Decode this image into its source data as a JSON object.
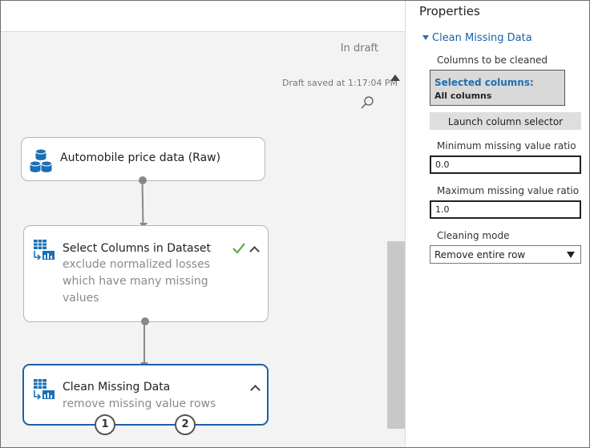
{
  "canvas": {
    "status": "In draft",
    "saved_text": "Draft saved at 1:17:04 PM",
    "modules": [
      {
        "title": "Automobile price data (Raw)",
        "description": ""
      },
      {
        "title": "Select Columns in Dataset",
        "description": "exclude normalized losses which have many missing values"
      },
      {
        "title": "Clean Missing Data",
        "description": "remove missing value rows"
      }
    ],
    "output_ports": [
      "1",
      "2"
    ]
  },
  "properties": {
    "title": "Properties",
    "section": "Clean Missing Data",
    "columns_label": "Columns to be cleaned",
    "selected_columns_label": "Selected columns:",
    "selected_columns_value": "All columns",
    "launch_button": "Launch column selector",
    "min_ratio_label": "Minimum missing value ratio",
    "min_ratio_value": "0.0",
    "max_ratio_label": "Maximum missing value ratio",
    "max_ratio_value": "1.0",
    "cleaning_mode_label": "Cleaning mode",
    "cleaning_mode_value": "Remove entire row"
  },
  "colors": {
    "accent": "#1e5fa8",
    "check": "#6ab04c"
  }
}
